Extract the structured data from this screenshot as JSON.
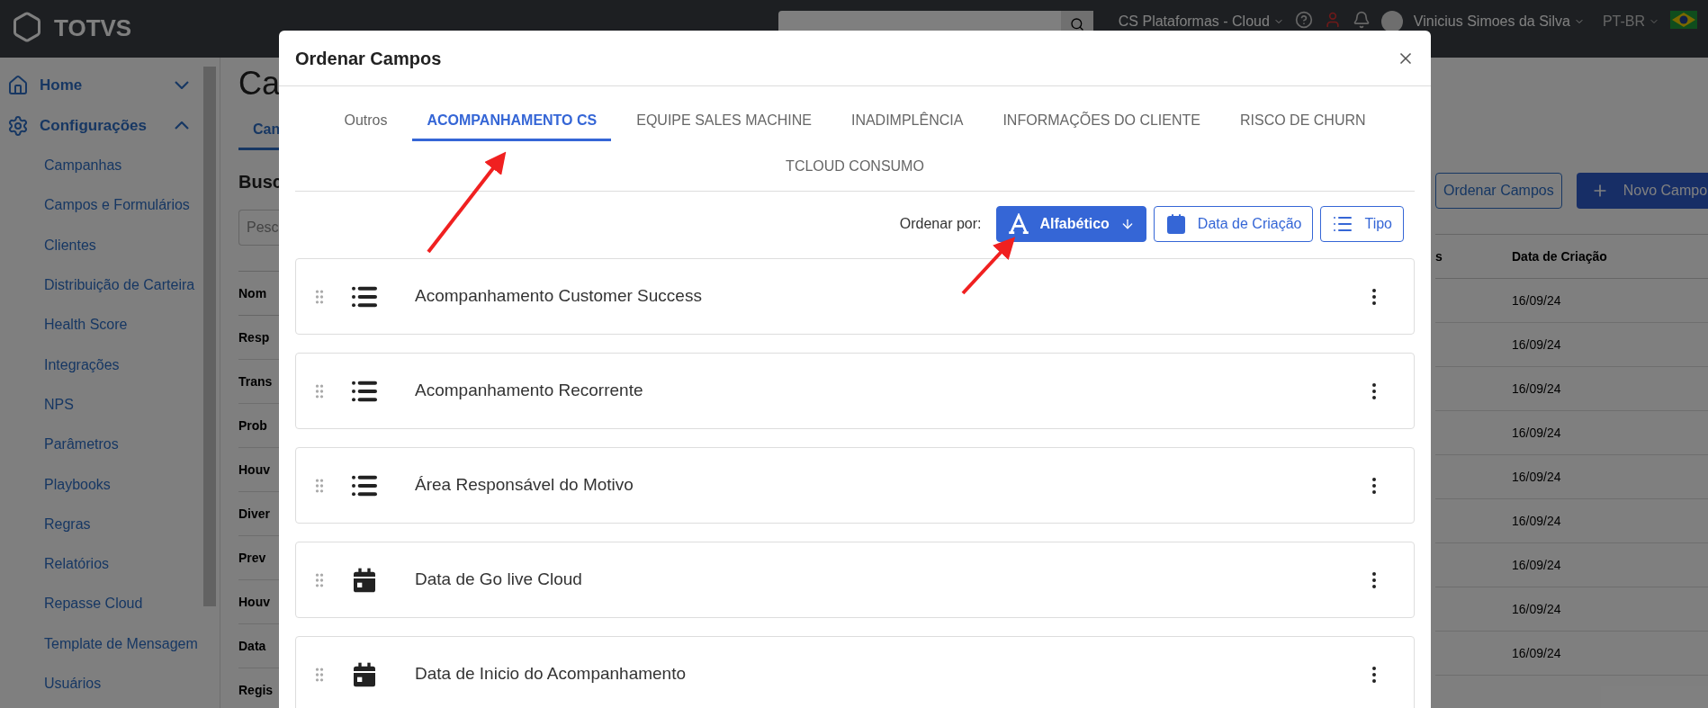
{
  "topbar": {
    "logo": "TOTVS",
    "workspace": "CS Plataformas - Cloud",
    "user": "Vinicius Simoes da Silva",
    "language": "PT-BR"
  },
  "sidebar": {
    "items": [
      {
        "label": "Home",
        "expanded": false
      },
      {
        "label": "Configurações",
        "expanded": true,
        "children": [
          {
            "label": "Campanhas"
          },
          {
            "label": "Campos e Formulários"
          },
          {
            "label": "Clientes"
          },
          {
            "label": "Distribuição de Carteira"
          },
          {
            "label": "Health Score"
          },
          {
            "label": "Integrações"
          },
          {
            "label": "NPS"
          },
          {
            "label": "Parâmetros"
          },
          {
            "label": "Playbooks"
          },
          {
            "label": "Regras"
          },
          {
            "label": "Relatórios"
          },
          {
            "label": "Repasse Cloud"
          },
          {
            "label": "Template de Mensagem"
          },
          {
            "label": "Usuários"
          }
        ]
      }
    ]
  },
  "page": {
    "title": "Ca",
    "tab": "Can",
    "section": "Busc",
    "search_placeholder": "Pesc",
    "column_1": "Nom",
    "rows_left": [
      "Resp",
      "Trans",
      "Prob",
      "Houv",
      "Diver",
      "Prev",
      "Houv",
      "Data",
      "Regis"
    ],
    "order_button": "Ordenar Campos",
    "new_button": "Novo Campo",
    "column_2": "s",
    "column_3": "Data de Criação",
    "dates": [
      "16/09/24",
      "16/09/24",
      "16/09/24",
      "16/09/24",
      "16/09/24",
      "16/09/24",
      "16/09/24",
      "16/09/24",
      "16/09/24"
    ]
  },
  "dialog": {
    "title": "Ordenar Campos",
    "tabs": [
      {
        "label": "Outros",
        "selected": false
      },
      {
        "label": "ACOMPANHAMENTO CS",
        "selected": true
      },
      {
        "label": "EQUIPE SALES MACHINE",
        "selected": false
      },
      {
        "label": "INADIMPLÊNCIA",
        "selected": false
      },
      {
        "label": "INFORMAÇÕES DO CLIENTE",
        "selected": false
      },
      {
        "label": "RISCO DE CHURN",
        "selected": false
      },
      {
        "label": "TCLOUD CONSUMO",
        "selected": false
      }
    ],
    "sort_label": "Ordenar por:",
    "sort_options": [
      {
        "label": "Alfabético",
        "kind": "alpha",
        "selected": true
      },
      {
        "label": "Data de Criação",
        "kind": "date",
        "selected": false
      },
      {
        "label": "Tipo",
        "kind": "type",
        "selected": false
      }
    ],
    "fields": [
      {
        "label": "Acompanhamento Customer Success",
        "kind": "list"
      },
      {
        "label": "Acompanhamento Recorrente",
        "kind": "list"
      },
      {
        "label": "Área Responsável do Motivo",
        "kind": "list"
      },
      {
        "label": "Data de Go live Cloud",
        "kind": "date"
      },
      {
        "label": "Data de Inicio do Acompanhamento",
        "kind": "date"
      }
    ]
  }
}
